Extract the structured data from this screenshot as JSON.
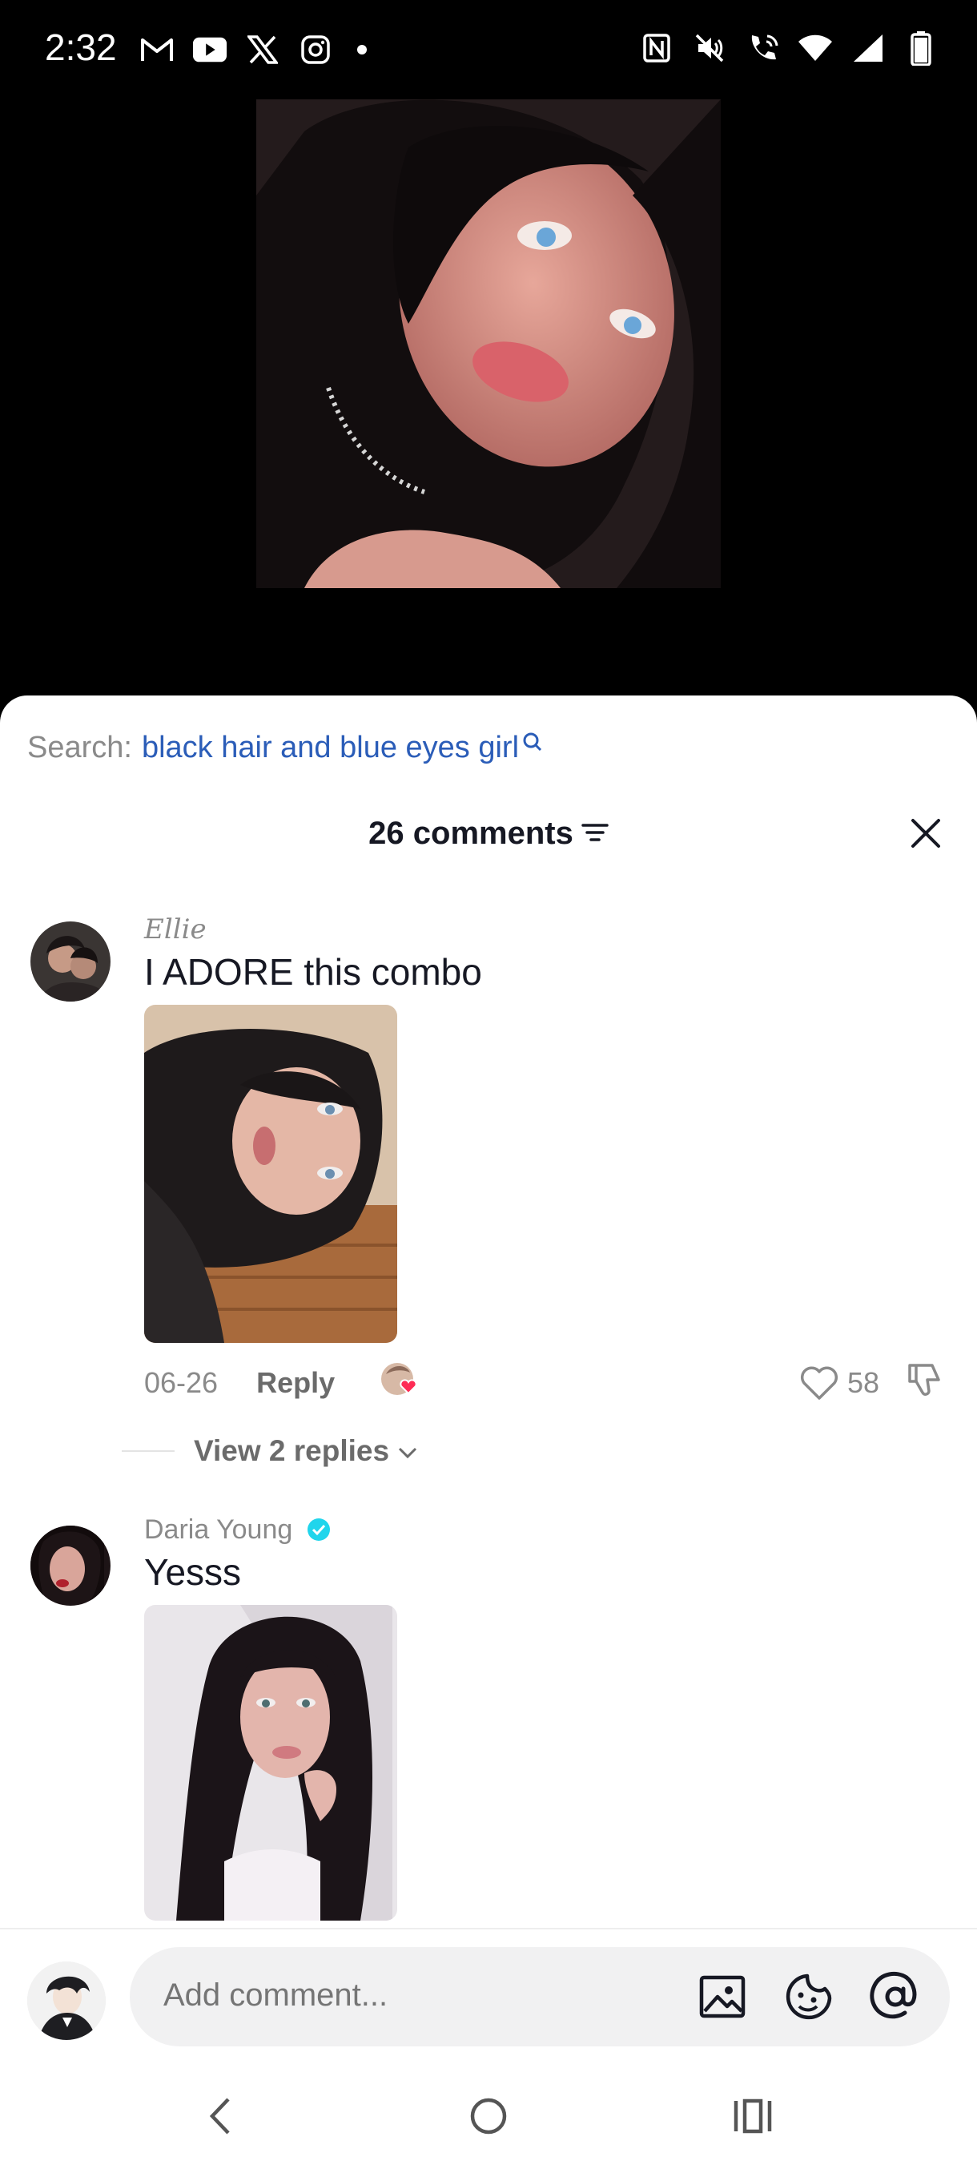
{
  "status": {
    "time": "2:32",
    "left_icons": [
      "gmail-icon",
      "youtube-icon",
      "x-icon",
      "instagram-icon",
      "dot-icon"
    ],
    "right_icons": [
      "nfc-icon",
      "mute-icon",
      "wifi-call-icon",
      "wifi-icon",
      "signal-icon",
      "battery-icon"
    ]
  },
  "search": {
    "prefix": "Search:",
    "term": "black hair and blue eyes girl"
  },
  "header": {
    "title": "26 comments"
  },
  "comments": [
    {
      "user": "Ellie",
      "text": "I ADORE this combo",
      "date": "06-26",
      "reply_label": "Reply",
      "likes": "58",
      "view_replies": "View 2 replies"
    },
    {
      "user": "Daria Young",
      "verified": true,
      "text": "Yesss"
    }
  ],
  "input": {
    "placeholder": "Add comment..."
  },
  "colors": {
    "accent_link": "#2b5db8",
    "verified": "#20d5ec",
    "heart_badge": "#fe2c55"
  }
}
